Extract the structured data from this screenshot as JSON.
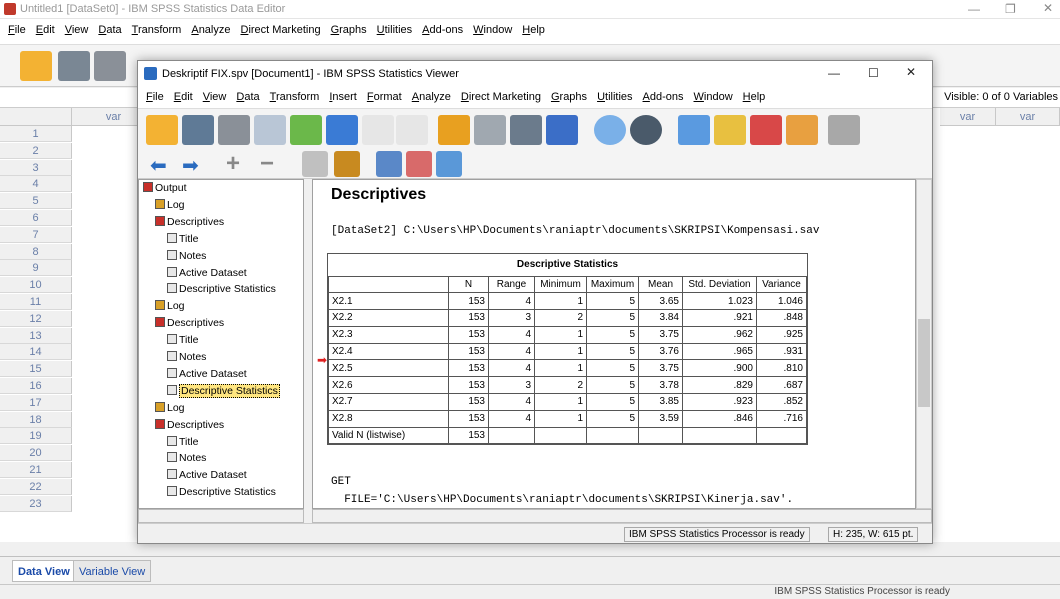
{
  "editor": {
    "title": "Untitled1 [DataSet0] - IBM SPSS Statistics Data Editor",
    "menu": [
      "File",
      "Edit",
      "View",
      "Data",
      "Transform",
      "Analyze",
      "Direct Marketing",
      "Graphs",
      "Utilities",
      "Add-ons",
      "Window",
      "Help"
    ],
    "visible_label": "Visible: 0 of 0 Variables",
    "column_label": "var",
    "rows": [
      "1",
      "2",
      "3",
      "4",
      "5",
      "6",
      "7",
      "8",
      "9",
      "10",
      "11",
      "12",
      "13",
      "14",
      "15",
      "16",
      "17",
      "18",
      "19",
      "20",
      "21",
      "22",
      "23"
    ],
    "tabs": [
      "Data View",
      "Variable View"
    ],
    "status": "IBM SPSS Statistics Processor is ready"
  },
  "viewer": {
    "title": "Deskriptif FIX.spv [Document1] - IBM SPSS Statistics Viewer",
    "menu": [
      "File",
      "Edit",
      "View",
      "Data",
      "Transform",
      "Insert",
      "Format",
      "Analyze",
      "Direct Marketing",
      "Graphs",
      "Utilities",
      "Add-ons",
      "Window",
      "Help"
    ],
    "outline": [
      {
        "label": "Output",
        "level": 0
      },
      {
        "label": "Log",
        "level": 1
      },
      {
        "label": "Descriptives",
        "level": 1
      },
      {
        "label": "Title",
        "level": 2
      },
      {
        "label": "Notes",
        "level": 2
      },
      {
        "label": "Active Dataset",
        "level": 2
      },
      {
        "label": "Descriptive Statistics",
        "level": 2
      },
      {
        "label": "Log",
        "level": 1
      },
      {
        "label": "Descriptives",
        "level": 1
      },
      {
        "label": "Title",
        "level": 2
      },
      {
        "label": "Notes",
        "level": 2
      },
      {
        "label": "Active Dataset",
        "level": 2
      },
      {
        "label": "Descriptive Statistics",
        "level": 2,
        "selected": true
      },
      {
        "label": "Log",
        "level": 1
      },
      {
        "label": "Descriptives",
        "level": 1
      },
      {
        "label": "Title",
        "level": 2
      },
      {
        "label": "Notes",
        "level": 2
      },
      {
        "label": "Active Dataset",
        "level": 2
      },
      {
        "label": "Descriptive Statistics",
        "level": 2
      }
    ],
    "heading": "Descriptives",
    "dataset_line": "[DataSet2] C:\\Users\\HP\\Documents\\raniaptr\\documents\\SKRIPSI\\Kompensasi.sav",
    "table": {
      "caption": "Descriptive Statistics",
      "headers": [
        "",
        "N",
        "Range",
        "Minimum",
        "Maximum",
        "Mean",
        "Std. Deviation",
        "Variance"
      ],
      "rows": [
        [
          "X2.1",
          "153",
          "4",
          "1",
          "5",
          "3.65",
          "1.023",
          "1.046"
        ],
        [
          "X2.2",
          "153",
          "3",
          "2",
          "5",
          "3.84",
          ".921",
          ".848"
        ],
        [
          "X2.3",
          "153",
          "4",
          "1",
          "5",
          "3.75",
          ".962",
          ".925"
        ],
        [
          "X2.4",
          "153",
          "4",
          "1",
          "5",
          "3.76",
          ".965",
          ".931"
        ],
        [
          "X2.5",
          "153",
          "4",
          "1",
          "5",
          "3.75",
          ".900",
          ".810"
        ],
        [
          "X2.6",
          "153",
          "3",
          "2",
          "5",
          "3.78",
          ".829",
          ".687"
        ],
        [
          "X2.7",
          "153",
          "4",
          "1",
          "5",
          "3.85",
          ".923",
          ".852"
        ],
        [
          "X2.8",
          "153",
          "4",
          "1",
          "5",
          "3.59",
          ".846",
          ".716"
        ],
        [
          "Valid N (listwise)",
          "153",
          "",
          "",
          "",
          "",
          "",
          ""
        ]
      ]
    },
    "syntax_get": "GET",
    "syntax_file": "  FILE='C:\\Users\\HP\\Documents\\raniaptr\\documents\\SKRIPSI\\Kinerja.sav'.",
    "status": "IBM SPSS Statistics Processor is ready",
    "dimensions": "H: 235, W: 615 pt."
  },
  "colors": {
    "accent": "#1a4aa8",
    "selection": "#ffe680",
    "arrow": "#e02020"
  }
}
